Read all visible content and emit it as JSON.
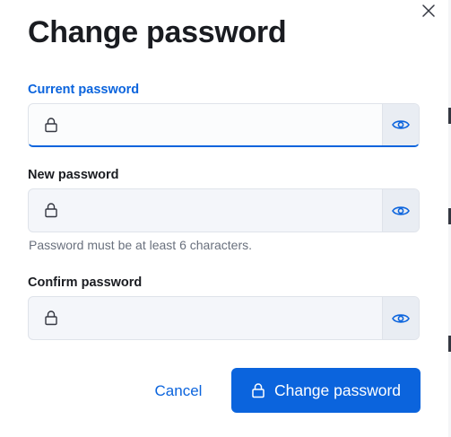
{
  "dialog": {
    "title": "Change password",
    "close_icon": "close-icon"
  },
  "fields": {
    "current": {
      "label": "Current password",
      "value": "",
      "type": "password",
      "focused": true,
      "leading_icon": "lock-icon",
      "toggle_icon": "eye-icon"
    },
    "new": {
      "label": "New password",
      "value": "",
      "type": "password",
      "help": "Password must be at least 6 characters.",
      "leading_icon": "lock-icon",
      "toggle_icon": "eye-icon"
    },
    "confirm": {
      "label": "Confirm password",
      "value": "",
      "type": "password",
      "leading_icon": "lock-icon",
      "toggle_icon": "eye-icon"
    }
  },
  "actions": {
    "cancel_label": "Cancel",
    "submit_label": "Change password",
    "submit_icon": "lock-icon"
  },
  "colors": {
    "primary": "#0b64dd",
    "title_text": "#1a1c21",
    "help_text": "#69707d",
    "field_bg": "#f4f6fa",
    "toggle_bg": "#e9edf3"
  }
}
